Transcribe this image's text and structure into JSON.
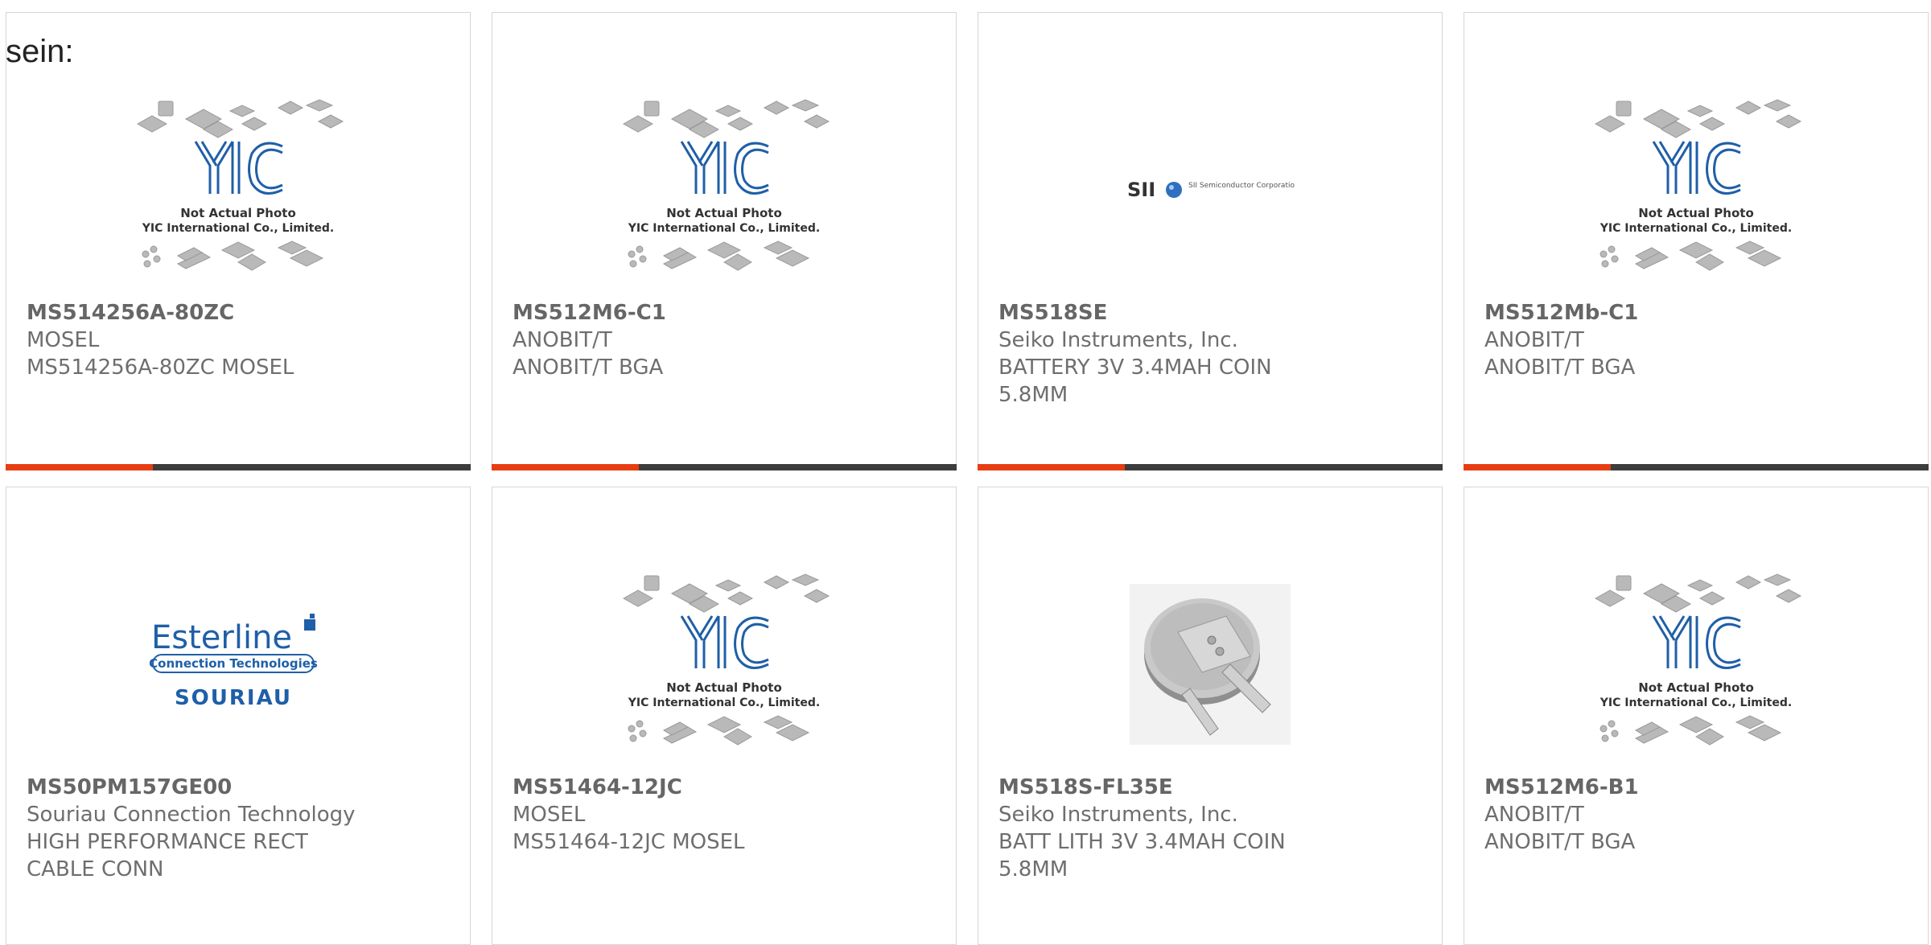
{
  "intro_text": "sein:",
  "colors": {
    "accent": "#e63e12",
    "bar": "#3d3d3d",
    "yic_blue": "#1f5fa8"
  },
  "products": [
    {
      "part": "MS514256A-80ZC",
      "maker": "MOSEL",
      "desc": "MS514256A-80ZC MOSEL",
      "desc2": "",
      "image": "yic-placeholder"
    },
    {
      "part": "MS512M6-C1",
      "maker": "ANOBIT/T",
      "desc": "ANOBIT/T BGA",
      "desc2": "",
      "image": "yic-placeholder"
    },
    {
      "part": "MS518SE",
      "maker": "Seiko Instruments, Inc.",
      "desc": "BATTERY 3V 3.4MAH COIN",
      "desc2": "5.8MM",
      "image": "sii-logo"
    },
    {
      "part": "MS512Mb-C1",
      "maker": "ANOBIT/T",
      "desc": "ANOBIT/T BGA",
      "desc2": "",
      "image": "yic-placeholder"
    },
    {
      "part": "MS50PM157GE00",
      "maker": "Souriau Connection Technology",
      "desc": "HIGH PERFORMANCE RECT",
      "desc2": "CABLE CONN",
      "image": "esterline-logo"
    },
    {
      "part": "MS51464-12JC",
      "maker": "MOSEL",
      "desc": "MS51464-12JC MOSEL",
      "desc2": "",
      "image": "yic-placeholder"
    },
    {
      "part": "MS518S-FL35E",
      "maker": "Seiko Instruments, Inc.",
      "desc": "BATT LITH 3V 3.4MAH COIN",
      "desc2": "5.8MM",
      "image": "coin-battery-photo"
    },
    {
      "part": "MS512M6-B1",
      "maker": "ANOBIT/T",
      "desc": "ANOBIT/T BGA",
      "desc2": "",
      "image": "yic-placeholder"
    }
  ],
  "yic": {
    "logo": "YIC",
    "line1": "Not Actual Photo",
    "line2": "YIC International Co., Limited."
  },
  "sii": {
    "logo": "SII",
    "tagline": "SII Semiconductor Corporation"
  },
  "esterline": {
    "name": "Esterline",
    "sub": "Connection Technologies",
    "brand": "SOURIAU"
  }
}
